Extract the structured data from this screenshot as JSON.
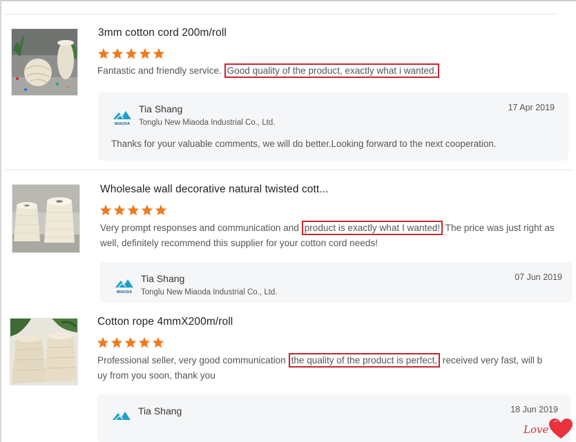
{
  "colors": {
    "star": "#f07a1c",
    "highlight": "#c9242d",
    "reply_bg": "#f5f6f8",
    "heart": "#e8323c"
  },
  "reviews": [
    {
      "title": "3mm cotton cord 200m/roll",
      "rating": 5,
      "comment_pre": "Fantastic and friendly service.",
      "comment_highlight": "Good quality of the product, exactly what i wanted.",
      "comment_post": "",
      "reply": {
        "logo_text": "MIAODA",
        "name": "Tia Shang",
        "company": "Tonglu New Miaoda Industrial Co., Ltd.",
        "date": "17 Apr 2019",
        "text": "Thanks for your valuable comments, we will do better.Looking forward to the next cooperation."
      }
    },
    {
      "title": "Wholesale wall decorative natural twisted cott...",
      "rating": 5,
      "comment_pre": "Very prompt responses and communication and",
      "comment_highlight": "product is exactly what I wanted!",
      "comment_post": "The price was just right as well, definitely recommend this supplier for your cotton cord needs!",
      "reply": {
        "logo_text": "MIAODA",
        "name": "Tia Shang",
        "company": "Tonglu New Miaoda Industrial Co., Ltd.",
        "date": "07 Jun 2019"
      }
    },
    {
      "title": "Cotton rope 4mmX200m/roll",
      "rating": 5,
      "comment_pre": "Professional seller, very good communication",
      "comment_highlight": "the quality of the product is perfect,",
      "comment_post": "received very fast, will buy from you soon, thank you",
      "reply": {
        "name": "Tia Shang",
        "date": "18 Jun 2019"
      }
    }
  ],
  "stamp_text": "Love"
}
